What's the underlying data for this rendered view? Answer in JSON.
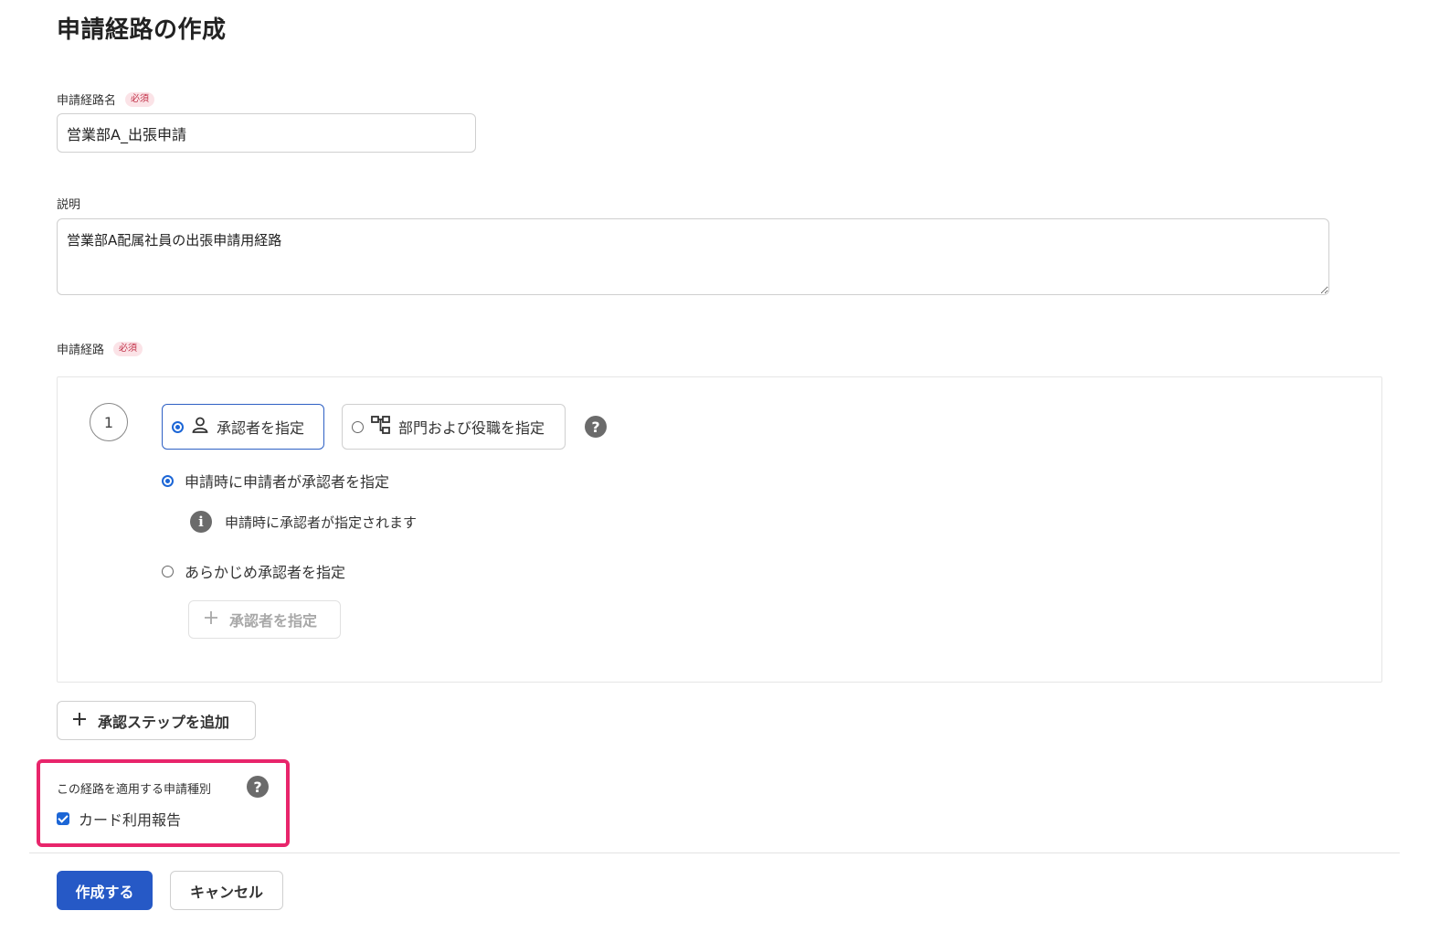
{
  "page": {
    "title": "申請経路の作成"
  },
  "route_name": {
    "label": "申請経路名",
    "required_badge": "必須",
    "value": "営業部A_出張申請"
  },
  "description": {
    "label": "説明",
    "value": "営業部A配属社員の出張申請用経路"
  },
  "route": {
    "label": "申請経路",
    "required_badge": "必須",
    "step_number": "1",
    "mode_options": [
      {
        "label": "承認者を指定",
        "selected": true
      },
      {
        "label": "部門および役職を指定",
        "selected": false
      }
    ],
    "approver_options": [
      {
        "label": "申請時に申請者が承認者を指定",
        "selected": true
      },
      {
        "label": "あらかじめ承認者を指定",
        "selected": false
      }
    ],
    "info_text": "申請時に承認者が指定されます",
    "specify_approver_button": "承認者を指定"
  },
  "add_step_button": "承認ステップを追加",
  "applicable_types": {
    "label": "この経路を適用する申請種別",
    "options": [
      {
        "label": "カード利用報告",
        "checked": true
      }
    ]
  },
  "actions": {
    "create": "作成する",
    "cancel": "キャンセル"
  },
  "colors": {
    "primary": "#2659c6",
    "highlight": "#e8256b",
    "radio_active": "#1c66d6"
  }
}
